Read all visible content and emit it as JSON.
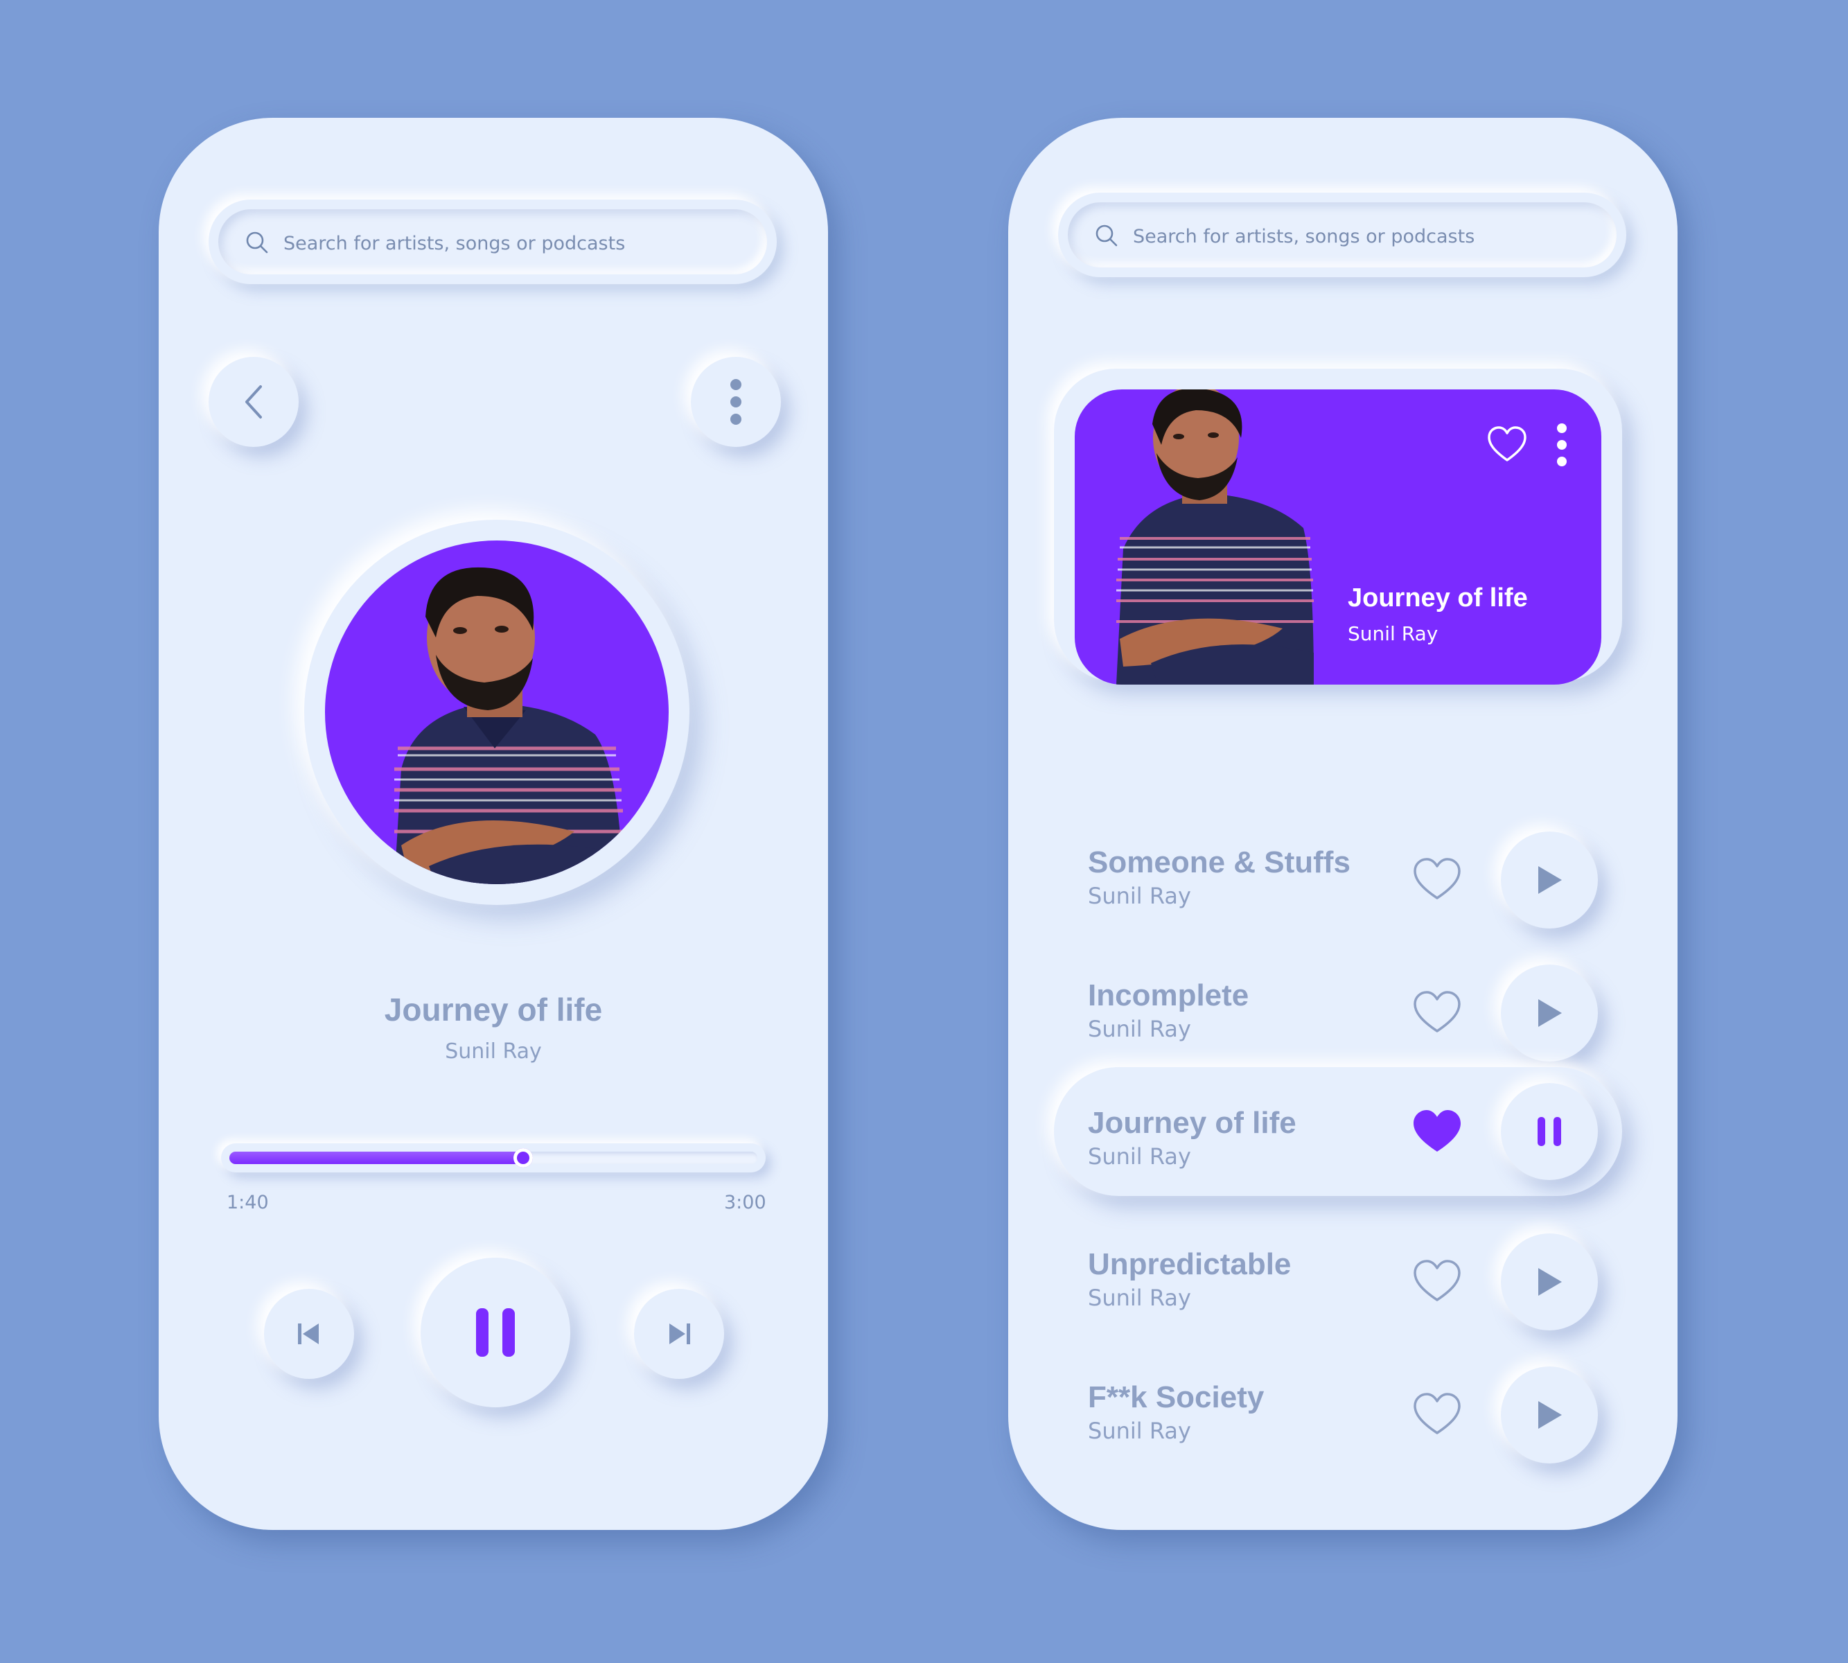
{
  "colors": {
    "background": "#7b9cd6",
    "surface": "#e6effd",
    "accent": "#7b2bff",
    "muted_text": "#8ea0c4"
  },
  "search": {
    "placeholder": "Search for artists, songs or podcasts"
  },
  "player": {
    "song_title": "Journey of life",
    "artist": "Sunil Ray",
    "elapsed": "1:40",
    "duration": "3:00",
    "progress_fraction": 0.556,
    "state": "playing"
  },
  "playlist": {
    "featured": {
      "title": "Journey of life",
      "artist": "Sunil Ray",
      "liked": false
    },
    "tracks": [
      {
        "title": "Someone & Stuffs",
        "artist": "Sunil Ray",
        "liked": false,
        "playing": false
      },
      {
        "title": "Incomplete",
        "artist": "Sunil Ray",
        "liked": false,
        "playing": false
      },
      {
        "title": "Journey of life",
        "artist": "Sunil Ray",
        "liked": true,
        "playing": true
      },
      {
        "title": "Unpredictable",
        "artist": "Sunil Ray",
        "liked": false,
        "playing": false
      },
      {
        "title": "F**k Society",
        "artist": "Sunil Ray",
        "liked": false,
        "playing": false
      }
    ]
  },
  "icons": {
    "search": "search-icon",
    "back": "chevron-left-icon",
    "more": "more-vertical-icon",
    "previous": "skip-previous-icon",
    "pause": "pause-icon",
    "next": "skip-next-icon",
    "play": "play-icon",
    "heart": "heart-icon",
    "artwork": "artist-photo"
  }
}
